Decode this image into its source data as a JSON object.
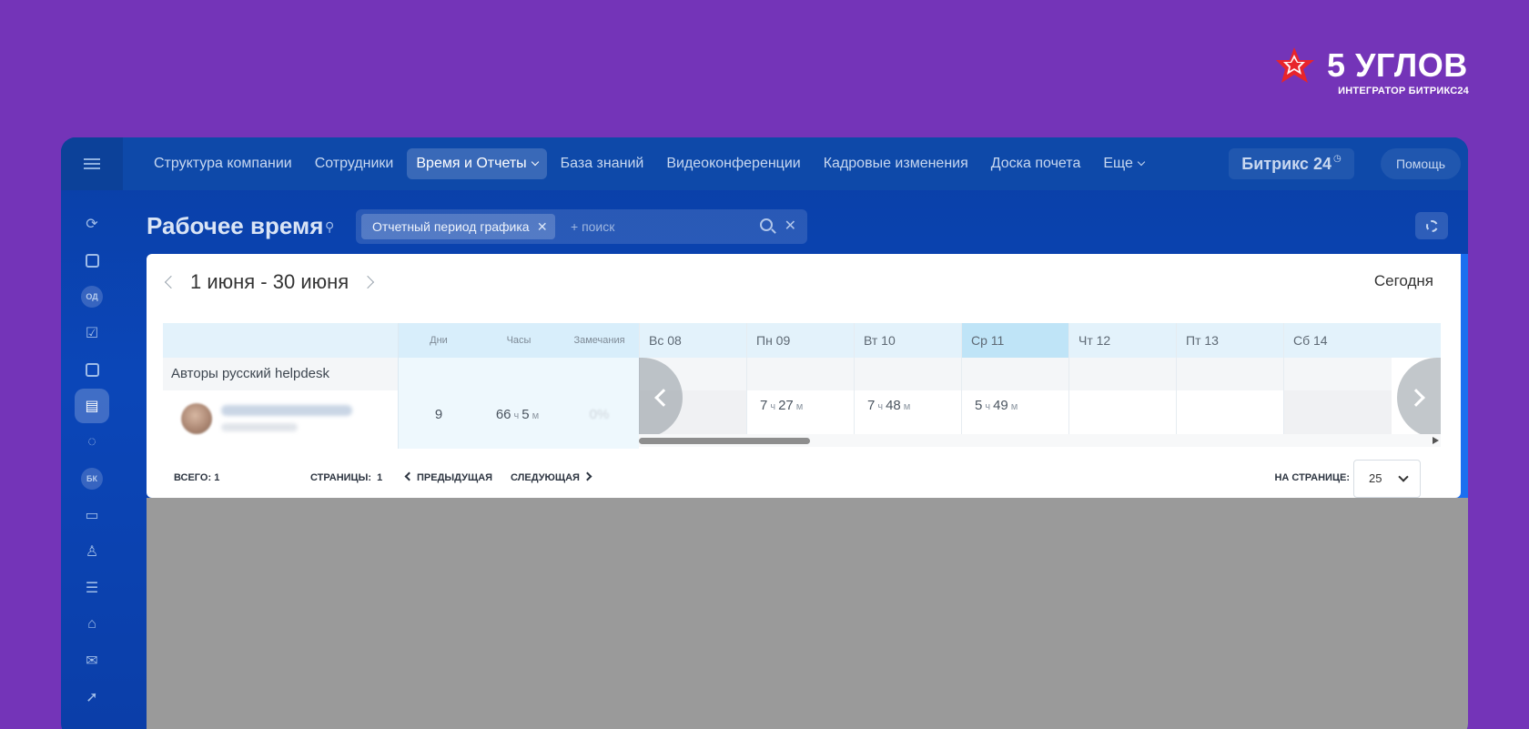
{
  "brand": {
    "name": "5 УГЛОВ",
    "subtitle": "ИНТЕГРАТОР БИТРИКС24",
    "star_color": "#e8242b"
  },
  "topnav": {
    "items": [
      {
        "label": "Структура компании"
      },
      {
        "label": "Сотрудники"
      },
      {
        "label": "Время и Отчеты",
        "active": true
      },
      {
        "label": "База знаний"
      },
      {
        "label": "Видеоконференции"
      },
      {
        "label": "Кадровые изменения"
      },
      {
        "label": "Доска почета"
      },
      {
        "label": "Еще"
      }
    ],
    "logo": "Битрикс 24",
    "help": "Помощь"
  },
  "sidebar": {
    "items": [
      {
        "icon": "sync-icon"
      },
      {
        "icon": "document-icon"
      },
      {
        "icon": "od-badge-icon",
        "text": "ОД"
      },
      {
        "icon": "tasks-icon"
      },
      {
        "icon": "calendar-icon"
      },
      {
        "icon": "time-reports-icon",
        "active": true
      },
      {
        "icon": "chat-icon"
      },
      {
        "icon": "bk-badge-icon",
        "text": "БК"
      },
      {
        "icon": "inbox-icon"
      },
      {
        "icon": "users-icon"
      },
      {
        "icon": "filter-icon"
      },
      {
        "icon": "robot-icon"
      },
      {
        "icon": "mail-icon"
      },
      {
        "icon": "rocket-icon"
      }
    ]
  },
  "page": {
    "title": "Рабочее время",
    "filter_chip": "Отчетный период графика",
    "search_placeholder": "+ поиск"
  },
  "report": {
    "range": "1 июня - 30 июня",
    "today": "Сегодня",
    "columns": {
      "days": "Дни",
      "hours": "Часы",
      "notes": "Замечания"
    },
    "group": "Авторы русский helpdesk",
    "employee": {
      "days": "9",
      "hours_h": "66",
      "hours_m": "5",
      "notes": "0%"
    },
    "unit_h": "ч",
    "unit_m": "м",
    "day_headers": [
      {
        "label": "Вс 08",
        "value": ""
      },
      {
        "label": "Пн 09",
        "value_h": "7",
        "value_m": "27"
      },
      {
        "label": "Вт 10",
        "value_h": "7",
        "value_m": "48"
      },
      {
        "label": "Ср 11",
        "value_h": "5",
        "value_m": "49",
        "highlight": true
      },
      {
        "label": "Чт 12",
        "value": ""
      },
      {
        "label": "Пт 13",
        "value": ""
      },
      {
        "label": "Сб 14",
        "value": ""
      }
    ],
    "footer": {
      "total_label": "ВСЕГО:",
      "total": "1",
      "pages_label": "СТРАНИЦЫ:",
      "pages": "1",
      "prev": "ПРЕДЫДУЩАЯ",
      "next": "СЛЕДУЮЩАЯ",
      "per_page_label": "НА СТРАНИЦЕ:",
      "per_page": "25"
    }
  }
}
